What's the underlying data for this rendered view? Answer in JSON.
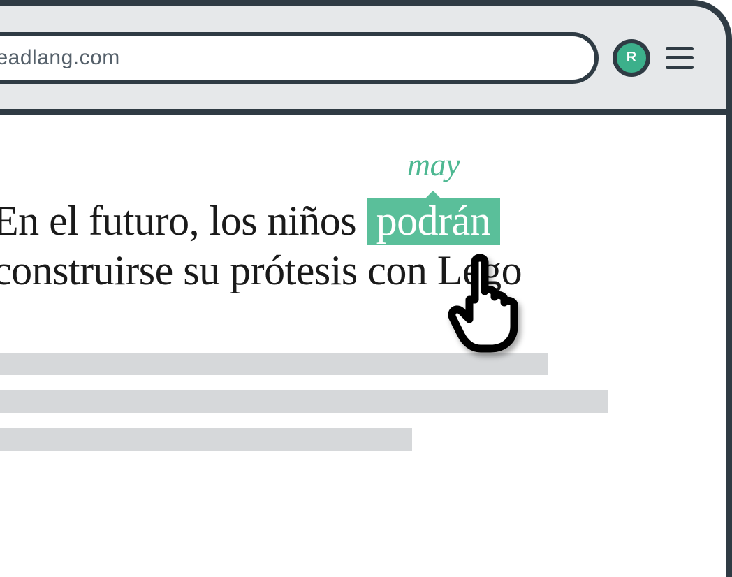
{
  "browser": {
    "url": "readlang.com",
    "extension_badge_letter": "R"
  },
  "article": {
    "headline_before": "En el futuro, los niños ",
    "highlighted_word": "podrán",
    "translation": "may",
    "headline_line2": "construirse su prótesis con Lego"
  },
  "colors": {
    "frame": "#2f3b44",
    "toolbar_bg": "#e6e8ea",
    "highlight": "#5abf9a",
    "translation_text": "#4eb892",
    "badge_bg": "#3cb08b",
    "placeholder": "#d6d8da"
  }
}
